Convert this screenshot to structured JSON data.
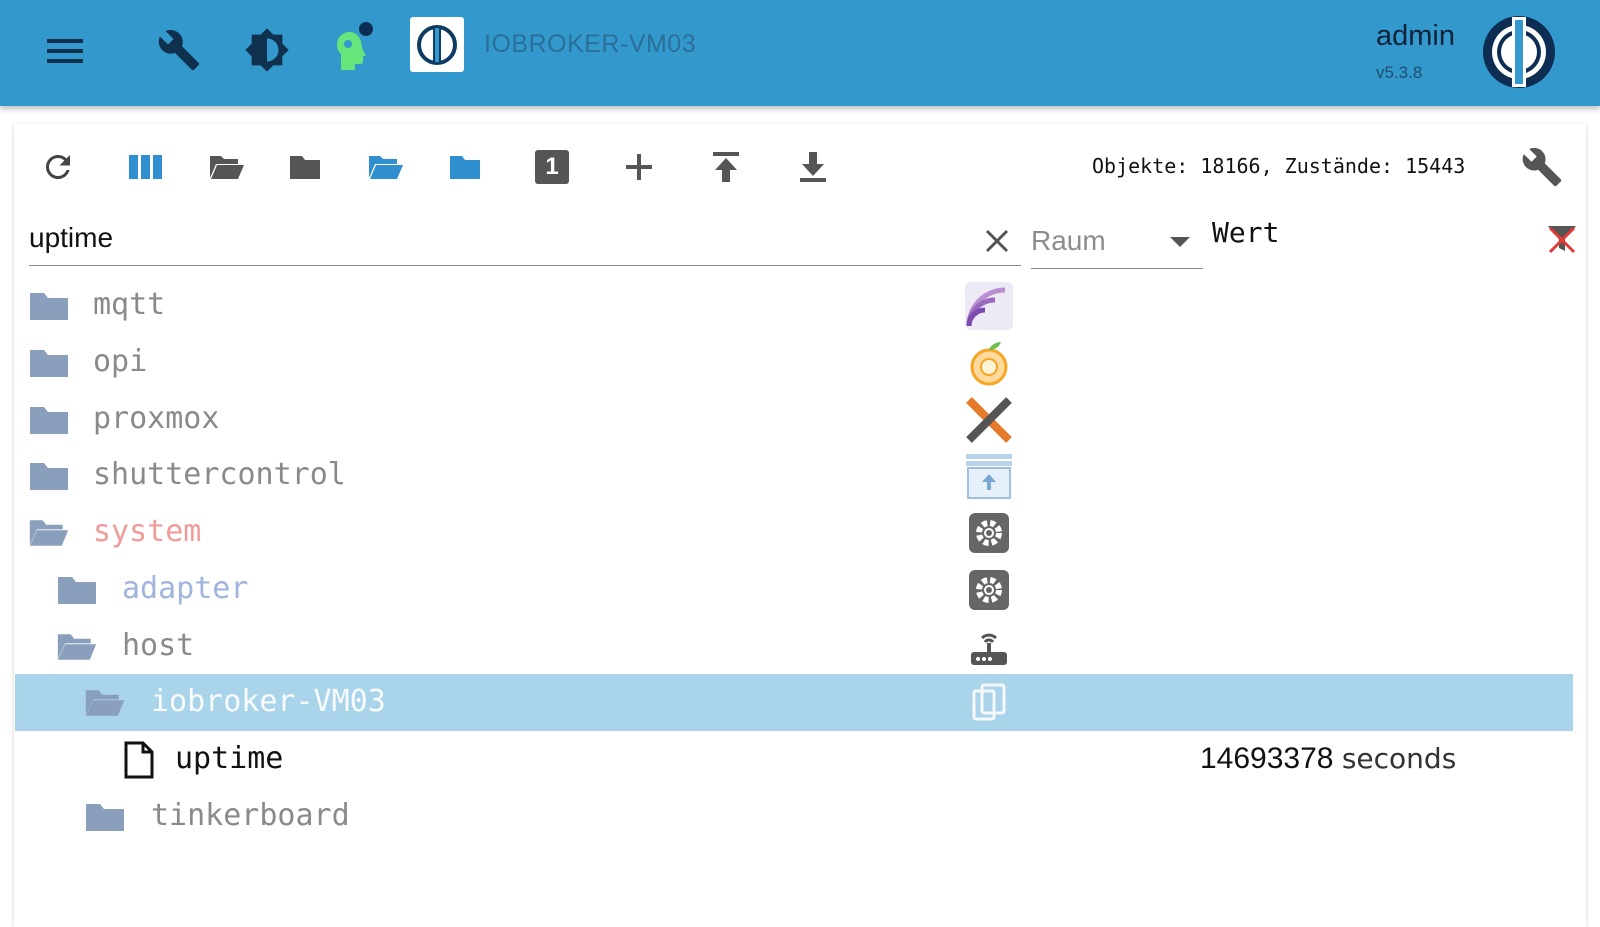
{
  "header": {
    "host_title": "IOBROKER-VM03",
    "user": "admin",
    "version": "v5.3.8",
    "icons": {
      "menu": "menu-icon",
      "settings": "wrench-icon",
      "theme": "brightness-icon",
      "expert": "expert-mode-icon",
      "logo": "iobroker-logo-icon",
      "avatar": "user-avatar-icon"
    },
    "colors": {
      "bar": "#3399cc",
      "badge": "#0d2d52",
      "expert": "#67e57a"
    }
  },
  "toolbar": {
    "buttons": [
      {
        "name": "refresh-icon"
      },
      {
        "name": "columns-icon"
      },
      {
        "name": "expand-all-icon"
      },
      {
        "name": "collapse-all-icon"
      },
      {
        "name": "expand-one-level-icon"
      },
      {
        "name": "collapse-one-level-icon"
      },
      {
        "name": "depth-number-icon"
      },
      {
        "name": "add-object-icon"
      },
      {
        "name": "upload-icon"
      },
      {
        "name": "download-icon"
      }
    ],
    "depth_label": "1",
    "stats": "Objekte: 18166, Zustände: 15443"
  },
  "filters": {
    "search_value": "uptime",
    "room_placeholder": "Raum",
    "value_column_label": "Wert"
  },
  "tree": {
    "rows": [
      {
        "label": "mqtt",
        "icon": "folder-closed",
        "adapter_icon": "mqtt-adapter-icon",
        "color": "#8a8a8a"
      },
      {
        "label": "opi",
        "icon": "folder-closed",
        "adapter_icon": "opi-adapter-icon",
        "color": "#8a8a8a"
      },
      {
        "label": "proxmox",
        "icon": "folder-closed",
        "adapter_icon": "proxmox-adapter-icon",
        "color": "#8a8a8a"
      },
      {
        "label": "shuttercontrol",
        "icon": "folder-closed",
        "adapter_icon": "shuttercontrol-adapter-icon",
        "color": "#8a8a8a"
      },
      {
        "label": "system",
        "icon": "folder-open",
        "adapter_icon": "system-gear-icon",
        "color": "#f09a9a"
      },
      {
        "label": "adapter",
        "icon": "folder-closed",
        "adapter_icon": "adapter-gear-icon",
        "color": "#a0b4de"
      },
      {
        "label": "host",
        "icon": "folder-open",
        "adapter_icon": "host-router-icon",
        "color": "#8a8a8a"
      },
      {
        "label": "iobroker-VM03",
        "icon": "folder-open",
        "adapter_icon": "copy-icon",
        "color": "#f8fbff",
        "selected": true
      },
      {
        "label": "uptime",
        "icon": "file",
        "value": "14693378",
        "unit": "seconds",
        "color": "#111111"
      },
      {
        "label": "tinkerboard",
        "icon": "folder-closed",
        "color": "#8a8a8a"
      }
    ]
  }
}
